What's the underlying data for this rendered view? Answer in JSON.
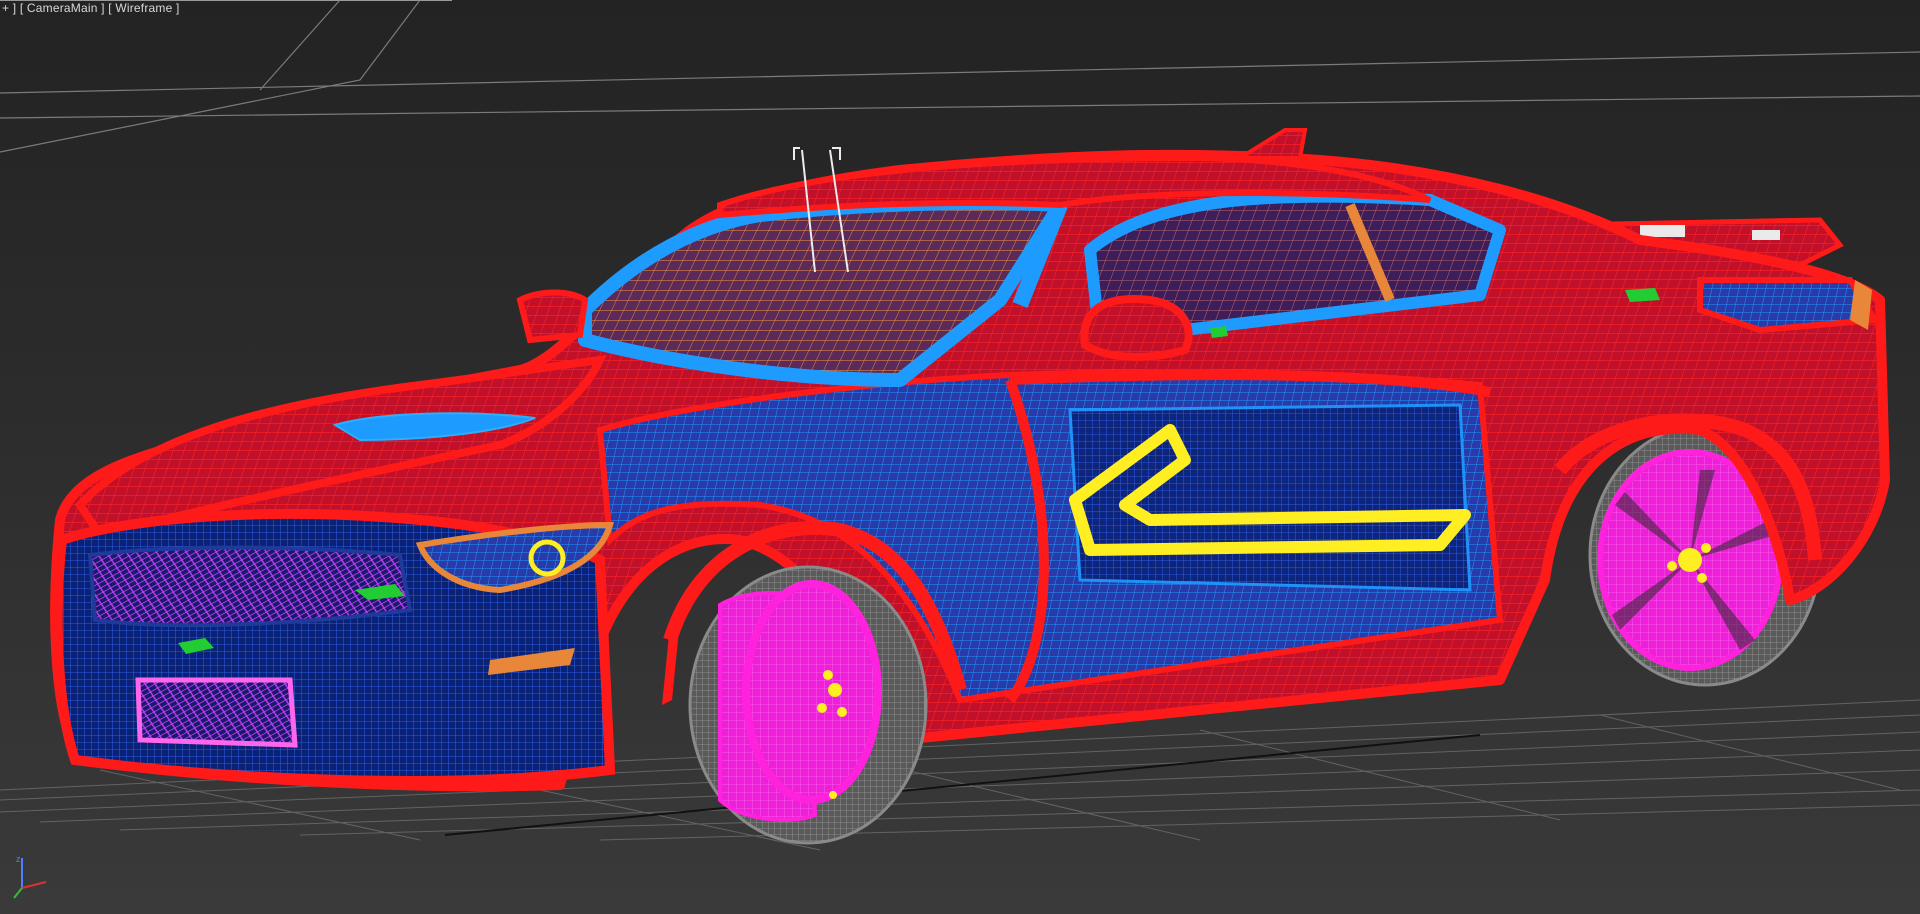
{
  "viewport": {
    "plus_menu": "+",
    "camera_label": "CameraMain",
    "shading_label": "Wireframe",
    "display_mode": "wireframe"
  },
  "scene": {
    "object": "sports-car-wireframe-model",
    "colors": {
      "body": "#ff1a1a",
      "inner": "#1e9bff",
      "dark_inner": "#0a2a8a",
      "wheels": "#ff22dd",
      "glass": "#e8873a",
      "trim": "#ffee22",
      "accents": "#22cc33",
      "grid": "#7a7a7a",
      "background": "#2d2d2d"
    }
  },
  "axis_gizmo": {
    "x_color": "#e03030",
    "y_color": "#30c030",
    "z_color": "#4f7fff"
  }
}
